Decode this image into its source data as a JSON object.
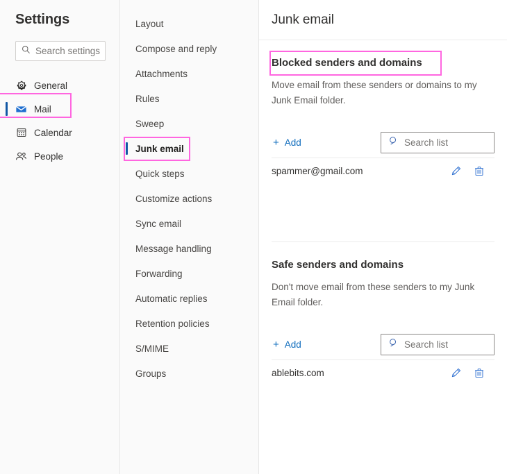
{
  "sidebar": {
    "title": "Settings",
    "search": {
      "placeholder": "Search settings",
      "value": "",
      "icon": "search-icon"
    },
    "items": [
      {
        "label": "General",
        "icon": "gear-icon",
        "selected": false
      },
      {
        "label": "Mail",
        "icon": "envelope-icon",
        "selected": true
      },
      {
        "label": "Calendar",
        "icon": "calendar-icon",
        "selected": false
      },
      {
        "label": "People",
        "icon": "people-icon",
        "selected": false
      }
    ]
  },
  "midnav": {
    "items": [
      {
        "label": "Layout",
        "selected": false
      },
      {
        "label": "Compose and reply",
        "selected": false
      },
      {
        "label": "Attachments",
        "selected": false
      },
      {
        "label": "Rules",
        "selected": false
      },
      {
        "label": "Sweep",
        "selected": false
      },
      {
        "label": "Junk email",
        "selected": true
      },
      {
        "label": "Quick steps",
        "selected": false
      },
      {
        "label": "Customize actions",
        "selected": false
      },
      {
        "label": "Sync email",
        "selected": false
      },
      {
        "label": "Message handling",
        "selected": false
      },
      {
        "label": "Forwarding",
        "selected": false
      },
      {
        "label": "Automatic replies",
        "selected": false
      },
      {
        "label": "Retention policies",
        "selected": false
      },
      {
        "label": "S/MIME",
        "selected": false
      },
      {
        "label": "Groups",
        "selected": false
      }
    ]
  },
  "main": {
    "title": "Junk email",
    "sections": [
      {
        "heading": "Blocked senders and domains",
        "description": "Move email from these senders or domains to my Junk Email folder.",
        "add_label": "Add",
        "search": {
          "placeholder": "Search list",
          "value": "",
          "icon": "search-icon"
        },
        "entries": [
          {
            "value": "spammer@gmail.com",
            "edit_icon": "pencil-icon",
            "delete_icon": "trash-icon"
          }
        ]
      },
      {
        "heading": "Safe senders and domains",
        "description": "Don't move email from these senders to my Junk Email folder.",
        "add_label": "Add",
        "search": {
          "placeholder": "Search list",
          "value": "",
          "icon": "search-icon"
        },
        "entries": [
          {
            "value": "ablebits.com",
            "edit_icon": "pencil-icon",
            "delete_icon": "trash-icon"
          }
        ]
      }
    ]
  },
  "annotations": {
    "highlight_color": "#ff66e0",
    "boxes": [
      "mail-sidebar-item",
      "junk-email-nav-item",
      "blocked-senders-heading"
    ]
  },
  "colors": {
    "accent_blue": "#0f6cbd",
    "selection_bar": "#1257a5",
    "panel_bg": "#fafafa",
    "divider": "#ebebeb",
    "text_primary": "#323130",
    "text_secondary": "#605e5c"
  }
}
